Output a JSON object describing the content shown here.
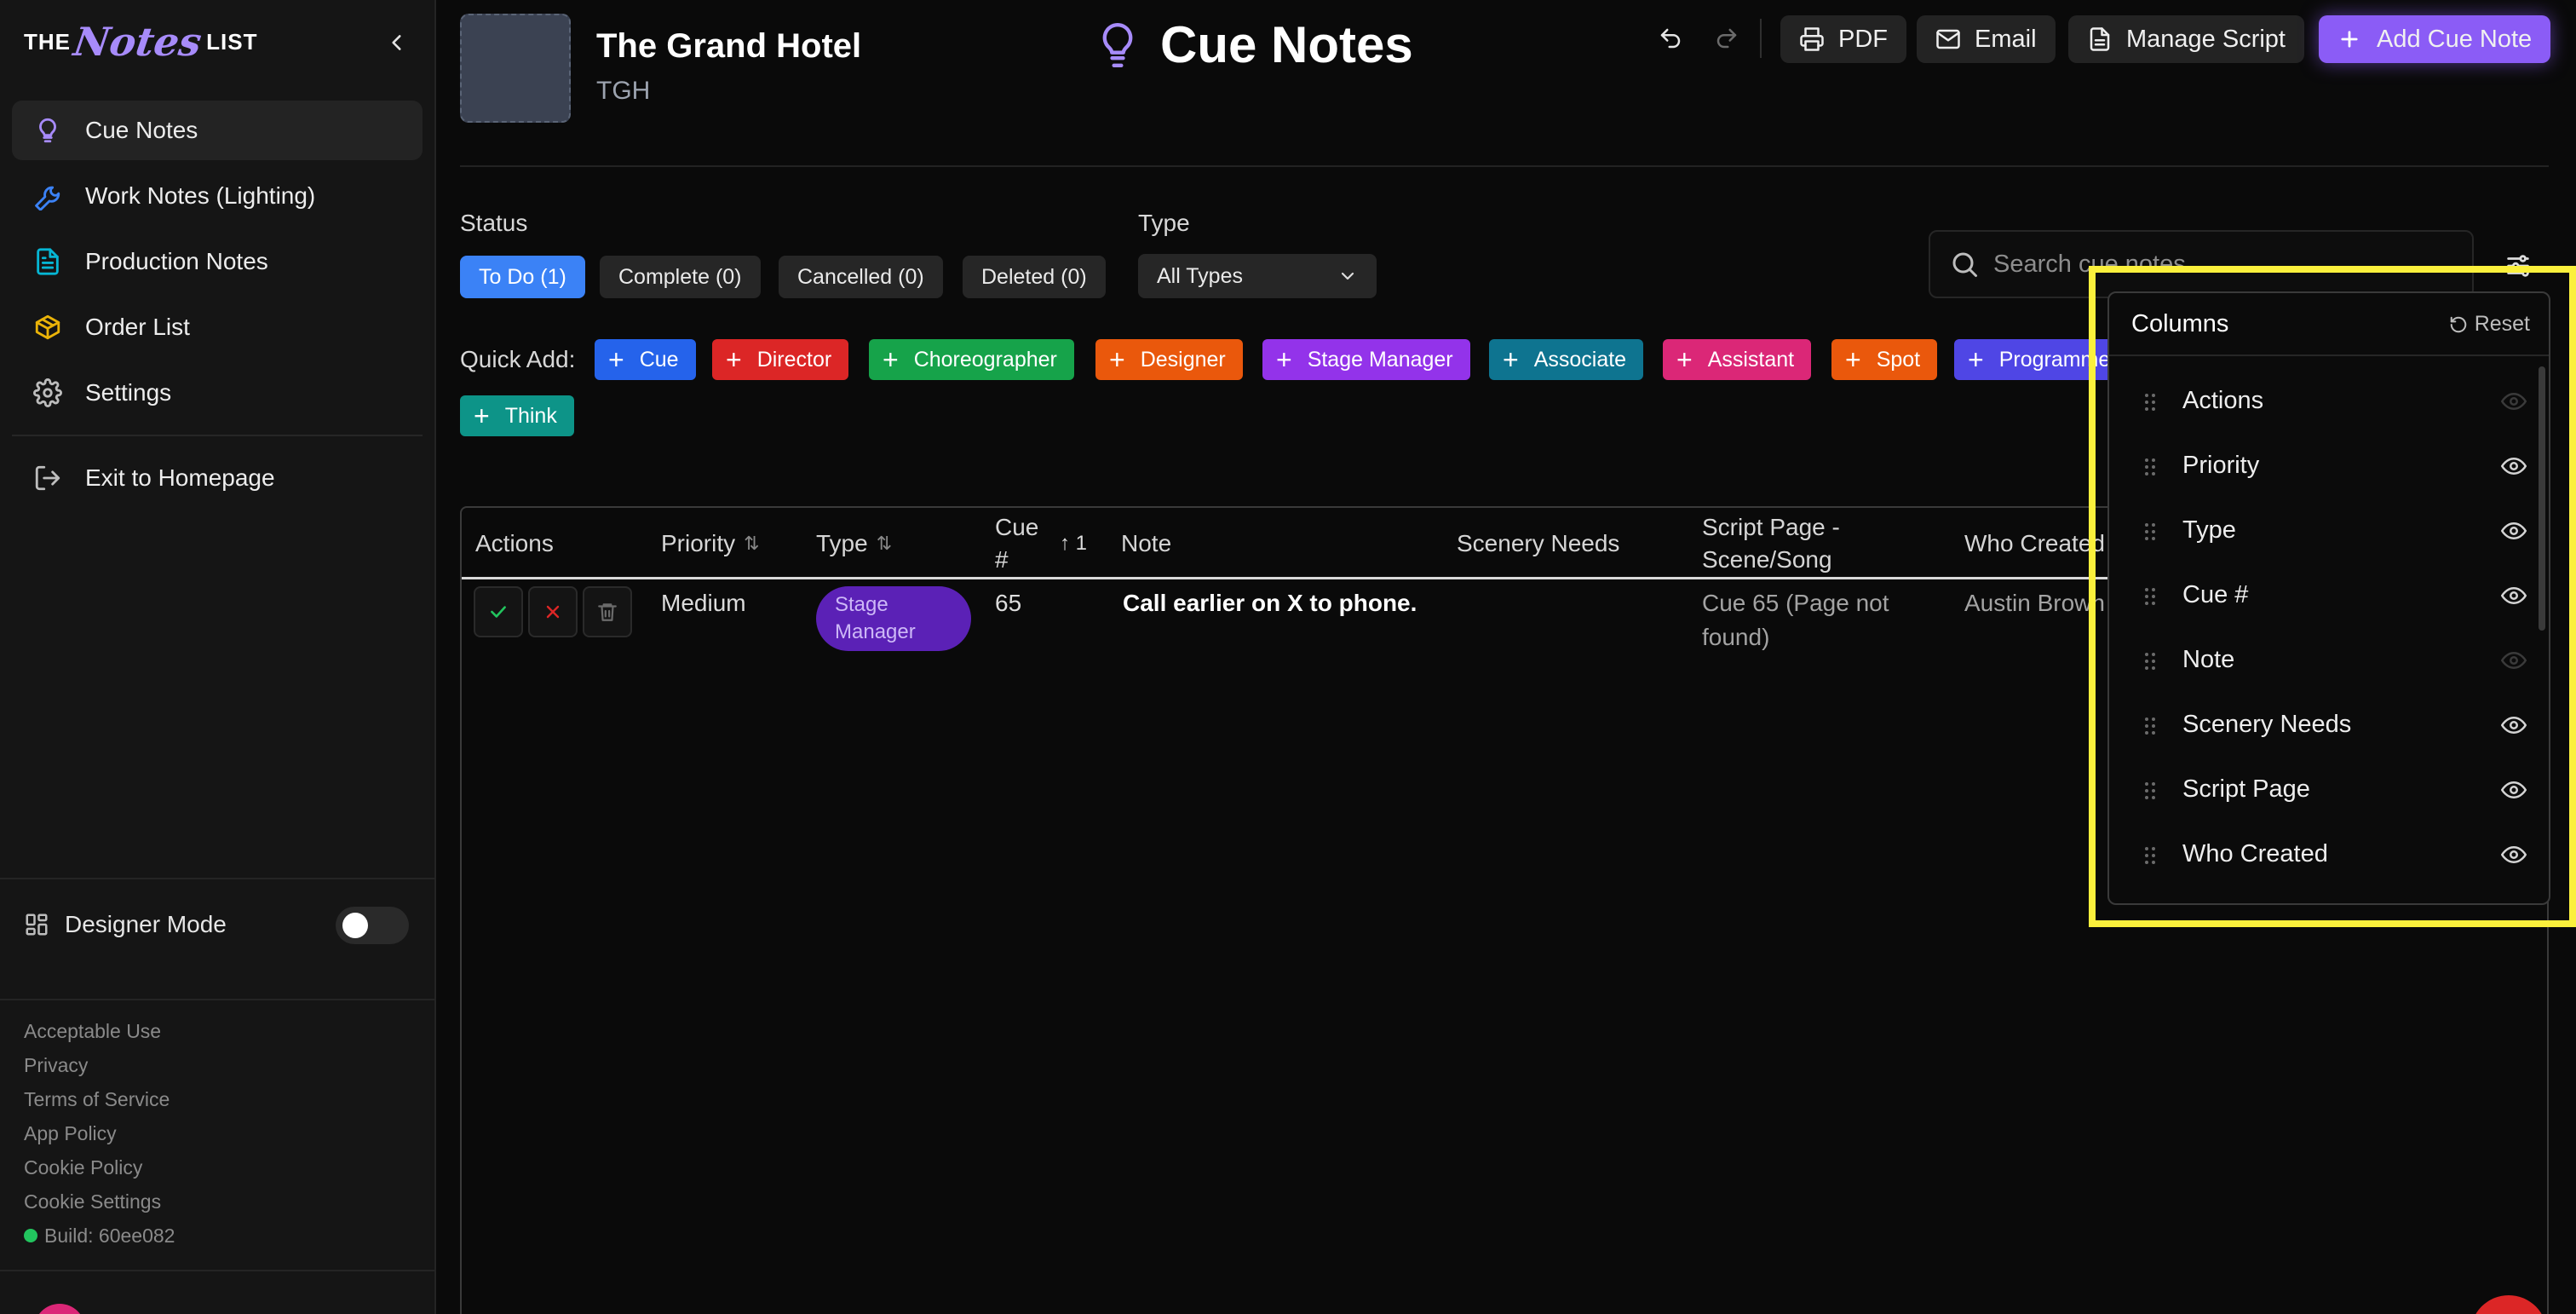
{
  "brand": {
    "the": "THE",
    "notes": "Notes",
    "list": "LIST"
  },
  "sidebar": {
    "items": [
      {
        "label": "Cue Notes",
        "icon": "lightbulb-icon",
        "active": true
      },
      {
        "label": "Work Notes (Lighting)",
        "icon": "wrench-icon"
      },
      {
        "label": "Production Notes",
        "icon": "document-icon"
      },
      {
        "label": "Order List",
        "icon": "box-icon"
      },
      {
        "label": "Settings",
        "icon": "gear-icon"
      }
    ],
    "exit_label": "Exit to Homepage",
    "designer_mode_label": "Designer Mode",
    "designer_mode_on": false,
    "footer_links": [
      "Acceptable Use",
      "Privacy",
      "Terms of Service",
      "App Policy",
      "Cookie Policy",
      "Cookie Settings"
    ],
    "build": "Build: 60ee082"
  },
  "header": {
    "production_title": "The Grand Hotel",
    "production_abbr": "TGH",
    "page_title": "Cue Notes",
    "buttons": {
      "pdf": "PDF",
      "email": "Email",
      "manage_script": "Manage Script",
      "add_cue_note": "Add Cue Note"
    }
  },
  "filters": {
    "status_label": "Status",
    "status_chips": [
      {
        "label": "To Do (1)",
        "active": true
      },
      {
        "label": "Complete (0)"
      },
      {
        "label": "Cancelled (0)"
      },
      {
        "label": "Deleted (0)"
      }
    ],
    "type_label": "Type",
    "type_value": "All Types",
    "search_placeholder": "Search cue notes..."
  },
  "quick_add": {
    "label": "Quick Add:",
    "items": [
      {
        "label": "Cue",
        "color": "#2563eb"
      },
      {
        "label": "Director",
        "color": "#dc2626"
      },
      {
        "label": "Choreographer",
        "color": "#16a34a"
      },
      {
        "label": "Designer",
        "color": "#ea580c"
      },
      {
        "label": "Stage Manager",
        "color": "#9333ea"
      },
      {
        "label": "Associate",
        "color": "#0e7490"
      },
      {
        "label": "Assistant",
        "color": "#db2777"
      },
      {
        "label": "Spot",
        "color": "#ea580c"
      },
      {
        "label": "Programmer",
        "color": "#4f46e5"
      },
      {
        "label": "Think",
        "color": "#0d9488"
      }
    ]
  },
  "table": {
    "headers": {
      "actions": "Actions",
      "priority": "Priority",
      "type": "Type",
      "cue_line1": "Cue",
      "cue_line2": "#",
      "cue_sort": "1",
      "note": "Note",
      "scenery": "Scenery Needs",
      "script_line1": "Script Page -",
      "script_line2": "Scene/Song",
      "who": "Who Created"
    },
    "rows": [
      {
        "priority": "Medium",
        "type_line1": "Stage",
        "type_line2": "Manager",
        "cue": "65",
        "note": "Call earlier on X to phone.",
        "scenery": "",
        "script_line1": "Cue 65 (Page not",
        "script_line2": "found)",
        "who": "Austin Brown"
      }
    ]
  },
  "columns_panel": {
    "title": "Columns",
    "reset_label": "Reset",
    "columns": [
      {
        "name": "Actions",
        "visible": false
      },
      {
        "name": "Priority",
        "visible": true
      },
      {
        "name": "Type",
        "visible": true
      },
      {
        "name": "Cue #",
        "visible": true
      },
      {
        "name": "Note",
        "visible": false
      },
      {
        "name": "Scenery Needs",
        "visible": true
      },
      {
        "name": "Script Page",
        "visible": true
      },
      {
        "name": "Who Created",
        "visible": true
      }
    ]
  },
  "colors": {
    "accent": "#8b5cf6",
    "active_chip": "#3b82f6",
    "highlight": "#fbf03c"
  }
}
